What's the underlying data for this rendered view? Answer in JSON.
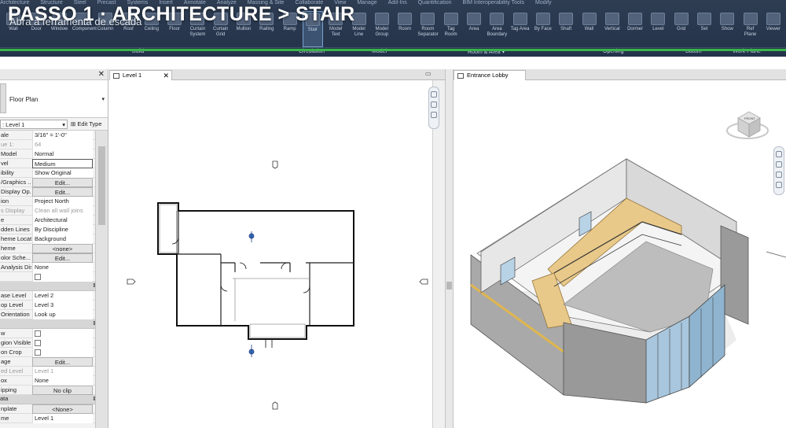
{
  "overlay": {
    "title": "PASSO 1 · ARCHITECTURE > STAIR",
    "subtitle": "Abra a ferramenta de escada"
  },
  "ribbon": {
    "tabs": [
      "Architecture",
      "Structure",
      "Steel",
      "Precast",
      "Systems",
      "Insert",
      "Annotate",
      "Analyze",
      "Massing & Site",
      "Collaborate",
      "View",
      "Manage",
      "Add-Ins",
      "Quantification",
      "BIM Interoperability Tools",
      "Modify"
    ],
    "tools": [
      {
        "label": "Wall"
      },
      {
        "label": "Door"
      },
      {
        "label": "Window"
      },
      {
        "label": "Component"
      },
      {
        "label": "Column"
      },
      {
        "label": "Roof"
      },
      {
        "label": "Ceiling"
      },
      {
        "label": "Floor"
      },
      {
        "label": "Curtain System"
      },
      {
        "label": "Curtain Grid"
      },
      {
        "label": "Mullion"
      },
      {
        "label": "Railing"
      },
      {
        "label": "Ramp"
      },
      {
        "label": "Stair"
      },
      {
        "label": "Model Text"
      },
      {
        "label": "Model Line"
      },
      {
        "label": "Model Group"
      },
      {
        "label": "Room"
      },
      {
        "label": "Room Separator"
      },
      {
        "label": "Tag Room"
      },
      {
        "label": "Area"
      },
      {
        "label": "Area Boundary"
      },
      {
        "label": "Tag Area"
      },
      {
        "label": "By Face"
      },
      {
        "label": "Shaft"
      },
      {
        "label": "Wall"
      },
      {
        "label": "Vertical"
      },
      {
        "label": "Dormer"
      },
      {
        "label": "Level"
      },
      {
        "label": "Grid"
      },
      {
        "label": "Set"
      },
      {
        "label": "Show"
      },
      {
        "label": "Ref Plane"
      },
      {
        "label": "Viewer"
      }
    ],
    "groups": [
      {
        "label": "Build"
      },
      {
        "label": "Circulation"
      },
      {
        "label": "Model"
      },
      {
        "label": "Room & Area ▾"
      },
      {
        "label": "Opening"
      },
      {
        "label": "Datum"
      },
      {
        "label": "Work Plane"
      }
    ]
  },
  "properties": {
    "close": "✕",
    "type_name": "Floor Plan",
    "filter_label": ": Level 1",
    "edit_type": "Edit Type",
    "rows": [
      {
        "k": "ale",
        "v": "3/16\" = 1'-0\"",
        "style": ""
      },
      {
        "k": "ue  1:",
        "v": "64",
        "style": "dim"
      },
      {
        "k": "Model",
        "v": "Normal",
        "style": ""
      },
      {
        "k": "vel",
        "v": "Medium",
        "style": "boxed"
      },
      {
        "k": "ibility",
        "v": "Show Original",
        "style": ""
      },
      {
        "k": "/Graphics ...",
        "v": "Edit...",
        "style": "btn"
      },
      {
        "k": "Display Op...",
        "v": "Edit...",
        "style": "btn"
      },
      {
        "k": "ion",
        "v": "Project North",
        "style": ""
      },
      {
        "k": "s Display",
        "v": "Clean all wall joins",
        "style": "dim"
      },
      {
        "k": "e",
        "v": "Architectural",
        "style": ""
      },
      {
        "k": "dden Lines",
        "v": "By Discipline",
        "style": ""
      },
      {
        "k": "heme Locat...",
        "v": "Background",
        "style": ""
      },
      {
        "k": "heme",
        "v": "<none>",
        "style": "btn"
      },
      {
        "k": "olor Sche...",
        "v": "Edit...",
        "style": "btn"
      },
      {
        "k": "Analysis Dis...",
        "v": "None",
        "style": ""
      },
      {
        "k": "",
        "v": "",
        "style": "check"
      }
    ],
    "rows2": [
      {
        "k": "ase Level",
        "v": "Level 2",
        "style": ""
      },
      {
        "k": "op Level",
        "v": "Level 3",
        "style": ""
      },
      {
        "k": "Orientation",
        "v": "Look up",
        "style": ""
      }
    ],
    "rows3": [
      {
        "k": "w",
        "v": "",
        "style": "check"
      },
      {
        "k": "gion Visible",
        "v": "",
        "style": "check"
      },
      {
        "k": "on Crop",
        "v": "",
        "style": "check"
      },
      {
        "k": "age",
        "v": "Edit...",
        "style": "btn"
      },
      {
        "k": "ed Level",
        "v": "Level 1",
        "style": "dim"
      },
      {
        "k": "ox",
        "v": "None",
        "style": ""
      },
      {
        "k": "ipping",
        "v": "No clip",
        "style": "btn"
      }
    ],
    "sec_ata": "ata",
    "rows4": [
      {
        "k": "nplate",
        "v": "<None>",
        "style": "btn"
      },
      {
        "k": "me",
        "v": "Level 1",
        "style": ""
      }
    ]
  },
  "plan_view": {
    "tab": "Level 1",
    "close": "✕"
  },
  "view3d": {
    "tab": "Entrance Lobby",
    "viewcube_label": "FRONT"
  }
}
